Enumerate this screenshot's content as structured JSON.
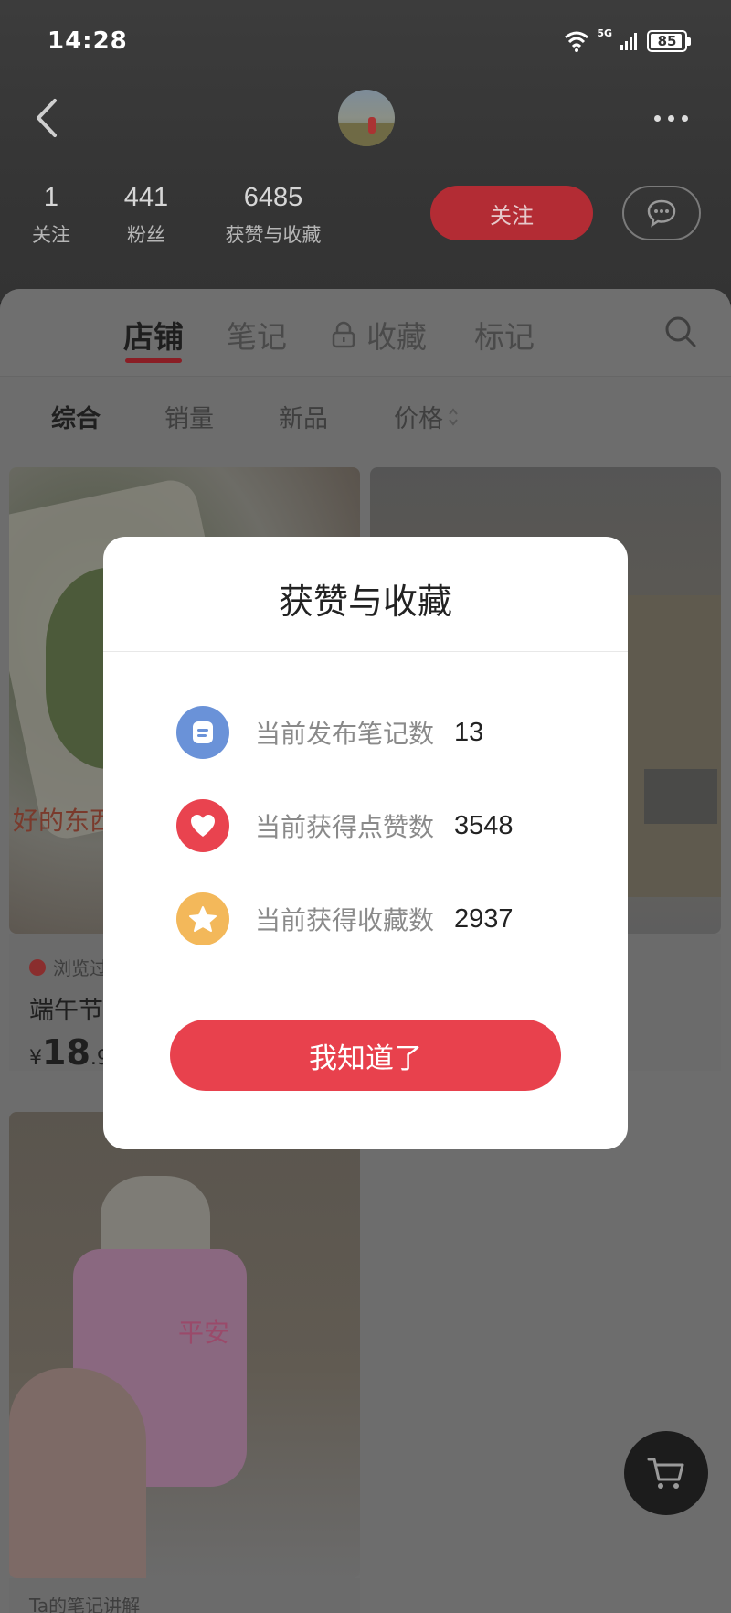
{
  "status_bar": {
    "time": "14:28",
    "battery": "85",
    "network": "5G"
  },
  "header": {
    "stats": [
      {
        "value": "1",
        "label": "关注"
      },
      {
        "value": "441",
        "label": "粉丝"
      },
      {
        "value": "6485",
        "label": "获赞与收藏"
      }
    ],
    "follow_label": "关注"
  },
  "tabs": [
    "店铺",
    "笔记",
    "收藏",
    "标记"
  ],
  "filters": [
    "综合",
    "销量",
    "新品",
    "价格"
  ],
  "products": [
    {
      "tag": "浏览过",
      "title": "端午节",
      "currency": "¥",
      "price_int": "18",
      "price_dec": ".9",
      "overlay": "好的东西"
    },
    {
      "pouch_text": "平安",
      "tag": "Ta的笔记讲解"
    }
  ],
  "modal": {
    "title": "获赞与收藏",
    "rows": [
      {
        "label": "当前发布笔记数",
        "value": "13"
      },
      {
        "label": "当前获得点赞数",
        "value": "3548"
      },
      {
        "label": "当前获得收藏数",
        "value": "2937"
      }
    ],
    "button_label": "我知道了"
  },
  "colors": {
    "accent": "#e8414d",
    "notes_icon": "#6a92d8",
    "likes_icon": "#e9434f",
    "collects_icon": "#f3b85a"
  }
}
